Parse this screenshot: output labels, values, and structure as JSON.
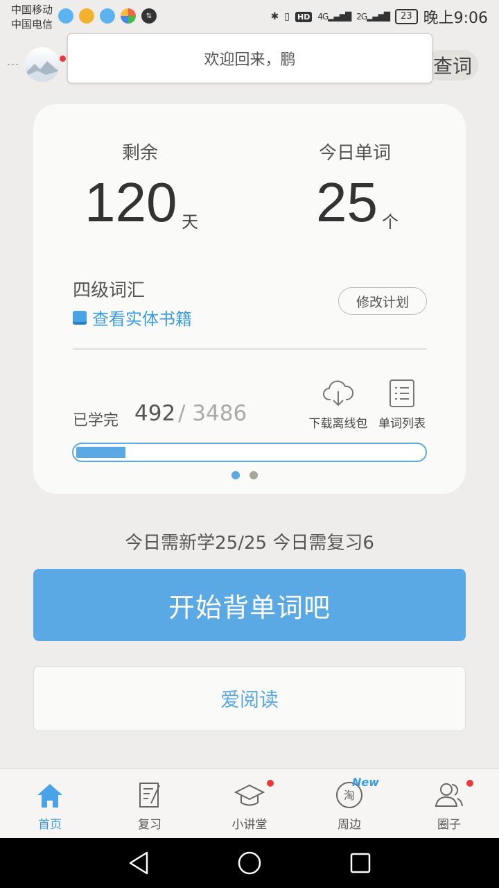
{
  "status_bar": {
    "carrier1": "中国移动",
    "carrier2": "中国电信",
    "hd": "HD",
    "sig1": "4G",
    "sig2": "2G",
    "battery": "23",
    "time": "晚上9:06"
  },
  "header": {
    "welcome_text": "欢迎回来，鹏",
    "lookup_label": "查词",
    "avatar_has_notification": true
  },
  "plan": {
    "remaining_label": "剩余",
    "remaining_value": "120",
    "remaining_unit": "天",
    "today_words_label": "今日单词",
    "today_words_value": "25",
    "today_words_unit": "个",
    "book_name": "四级词汇",
    "book_link": "查看实体书籍",
    "edit_button": "修改计划",
    "learned_label": "已学完",
    "learned_count": "492",
    "learned_total": "/ 3486",
    "progress_fraction": 0.141,
    "download_label": "下载离线包",
    "wordlist_label": "单词列表",
    "page_dots": 2,
    "active_page": 0
  },
  "today_summary": "今日需新学25/25  今日需复习6",
  "start_button": "开始背单词吧",
  "read_button": "爱阅读",
  "bottom_nav": {
    "items": [
      {
        "label": "首页",
        "icon": "home-icon",
        "active": true
      },
      {
        "label": "复习",
        "icon": "review-icon",
        "active": false
      },
      {
        "label": "小讲堂",
        "icon": "graduation-cap-icon",
        "active": false,
        "badge": true
      },
      {
        "label": "周边",
        "icon": "taobao-icon",
        "active": false,
        "new_tag": "New"
      },
      {
        "label": "圈子",
        "icon": "people-icon",
        "active": false,
        "badge": true
      }
    ]
  },
  "colors": {
    "accent": "#5aa9e4",
    "background": "#eeedeb",
    "card": "#fafaf9",
    "badge": "#e43c3c"
  }
}
